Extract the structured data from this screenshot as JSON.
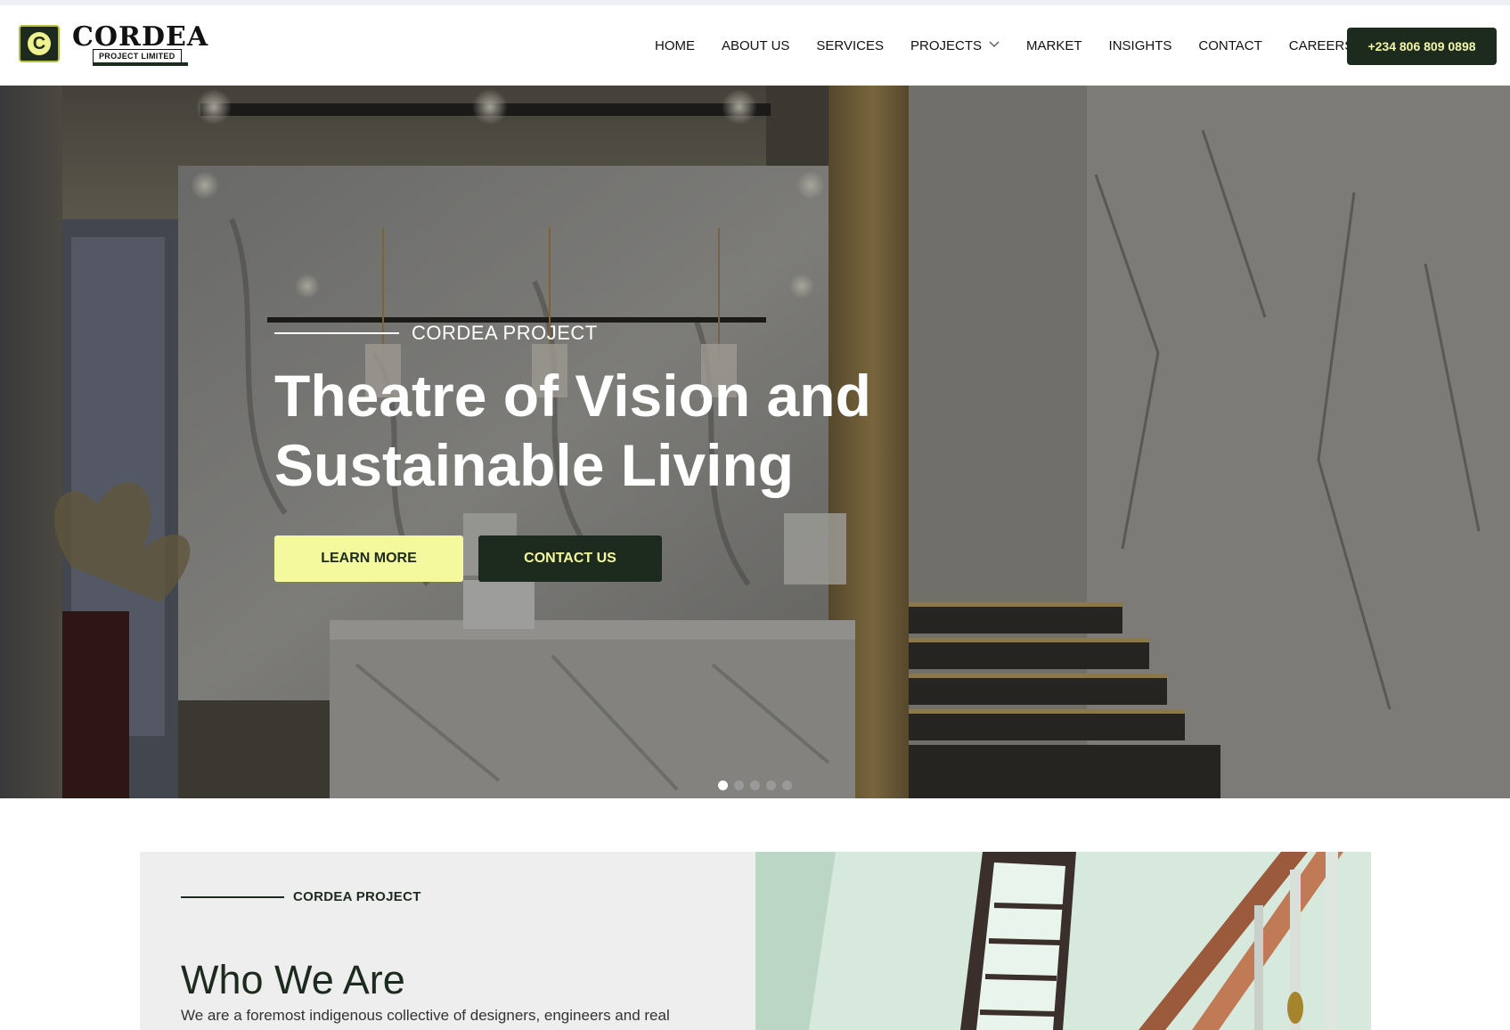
{
  "header": {
    "logo_word": "CORDEA",
    "logo_sub": "PROJECT LIMITED",
    "nav": [
      {
        "label": "HOME"
      },
      {
        "label": "ABOUT US"
      },
      {
        "label": "SERVICES"
      },
      {
        "label": "PROJECTS",
        "has_dropdown": true
      },
      {
        "label": "MARKET"
      },
      {
        "label": "INSIGHTS"
      },
      {
        "label": "CONTACT"
      },
      {
        "label": "CAREERS"
      }
    ],
    "phone": "+234 806 809 0898"
  },
  "hero": {
    "eyebrow": "CORDEA PROJECT",
    "title": "Theatre of Vision and Sustainable Living",
    "learn_more": "LEARN MORE",
    "contact_us": "CONTACT US",
    "slides": 5,
    "active_slide": 1
  },
  "about": {
    "eyebrow": "CORDEA PROJECT",
    "title": "Who We Are",
    "text": "We are a foremost indigenous collective of designers, engineers and real"
  },
  "colors": {
    "brand_dark": "#1d2a1e",
    "brand_accent": "#f4f99d"
  }
}
